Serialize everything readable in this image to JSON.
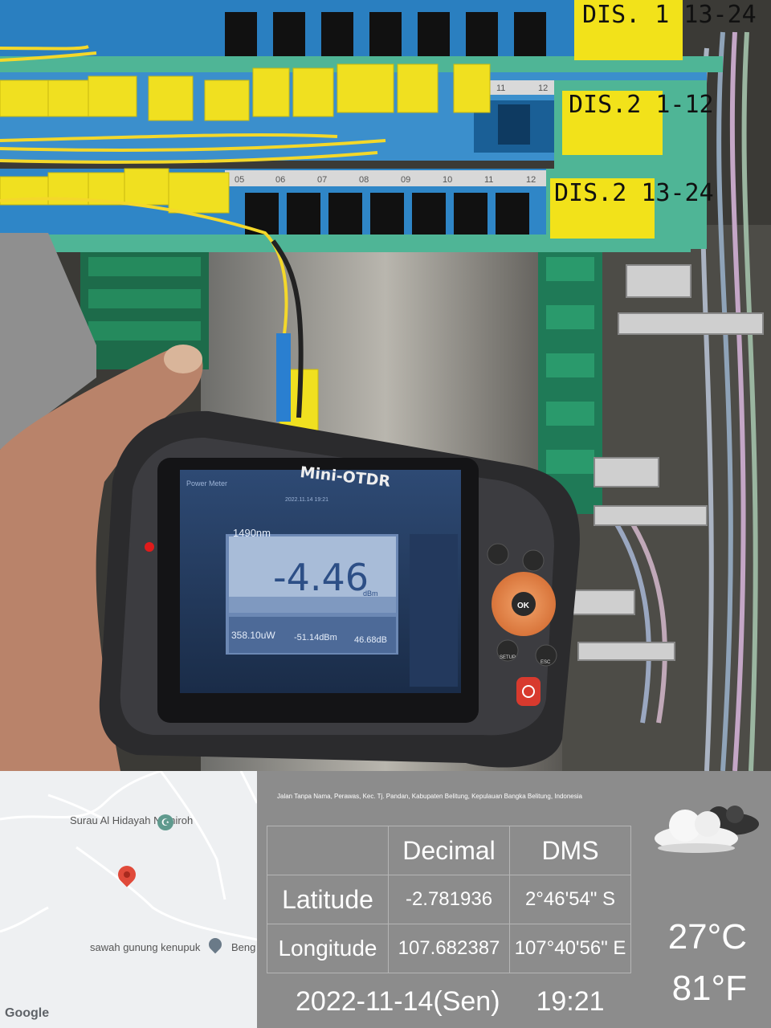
{
  "photo": {
    "panel_labels": [
      "DIS. 1 13-24",
      "DIS.2 1-12",
      "DIS.2 13-24"
    ],
    "port_numbers_row2": [
      "11",
      "12"
    ],
    "port_numbers_row3": [
      "05",
      "06",
      "07",
      "08",
      "09",
      "10",
      "11",
      "12"
    ],
    "device": {
      "brand": "Mini-OTDR",
      "mode": "Power Meter",
      "timestamp": "2022.11.14 19:21",
      "wavelength": "1490nm",
      "reading": "-4.46",
      "reading_unit": "dBm",
      "sub_readings": [
        "358.10uW",
        "-51.14dBm",
        "46.68dB"
      ],
      "button_labels": [
        "OK",
        "SETUP",
        "ESC"
      ]
    }
  },
  "map": {
    "places": [
      "Surau Al Hidayah Namiroh",
      "sawah gunung kenupuk",
      "Beng"
    ],
    "logo": "Google"
  },
  "location": {
    "address": "Jalan Tanpa Nama, Perawas, Kec. Tj. Pandan, Kabupaten Belitung, Kepulauan Bangka Belitung, Indonesia",
    "headers": [
      "Decimal",
      "DMS"
    ],
    "latitude": {
      "label": "Latitude",
      "decimal": "-2.781936",
      "dms": "2°46'54\" S"
    },
    "longitude": {
      "label": "Longitude",
      "decimal": "107.682387",
      "dms": "107°40'56\" E"
    }
  },
  "weather": {
    "icon": "cloud-night-icon",
    "celsius": "27°C",
    "fahrenheit": "81°F"
  },
  "datetime": {
    "date": "2022-11-14(Sen)",
    "time": "19:21"
  }
}
